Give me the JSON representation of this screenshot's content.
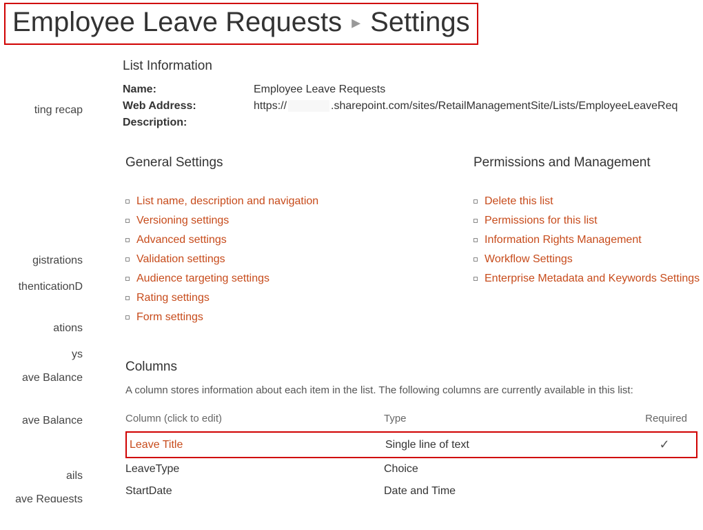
{
  "breadcrumb": {
    "parent": "Employee Leave Requests",
    "current": "Settings"
  },
  "sidebar": {
    "items": [
      "ting recap",
      "gistrations",
      "thenticationD",
      "ations",
      "ys",
      "ave Balance",
      "ave Balance",
      "ails",
      "ave Requests"
    ]
  },
  "list_info": {
    "heading": "List Information",
    "name_label": "Name:",
    "name_value": "Employee Leave Requests",
    "web_label": "Web Address:",
    "web_prefix": "https://",
    "web_suffix": ".sharepoint.com/sites/RetailManagementSite/Lists/EmployeeLeaveReq",
    "desc_label": "Description:"
  },
  "general": {
    "heading": "General Settings",
    "links": [
      "List name, description and navigation",
      "Versioning settings",
      "Advanced settings",
      "Validation settings",
      "Audience targeting settings",
      "Rating settings",
      "Form settings"
    ]
  },
  "permissions": {
    "heading": "Permissions and Management",
    "links": [
      "Delete this list",
      "Permissions for this list",
      "Information Rights Management",
      "Workflow Settings",
      "Enterprise Metadata and Keywords Settings"
    ]
  },
  "columns": {
    "heading": "Columns",
    "description": "A column stores information about each item in the list. The following columns are currently available in this list:",
    "header_name": "Column (click to edit)",
    "header_type": "Type",
    "header_required": "Required",
    "rows": [
      {
        "name": "Leave Title",
        "type": "Single line of text",
        "required": true,
        "highlight": true
      },
      {
        "name": "LeaveType",
        "type": "Choice",
        "required": false,
        "highlight": false
      },
      {
        "name": "StartDate",
        "type": "Date and Time",
        "required": false,
        "highlight": false
      }
    ]
  },
  "glyphs": {
    "chevron": "▸",
    "check": "✓"
  }
}
